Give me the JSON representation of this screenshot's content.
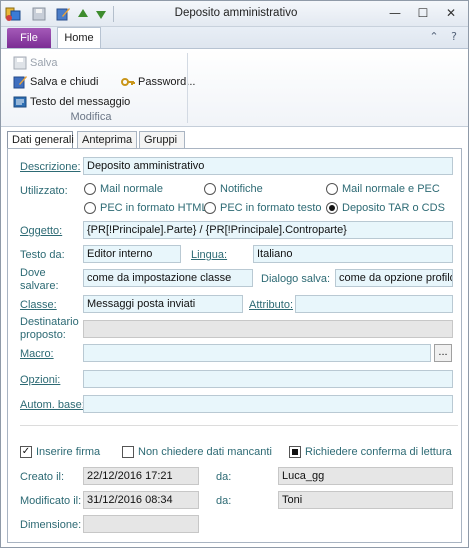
{
  "window": {
    "title": "Deposito amministrativo"
  },
  "quick_access": {
    "icons": [
      "app-icon",
      "save-icon",
      "edit-icon",
      "up-arrow-icon",
      "down-arrow-icon"
    ]
  },
  "ribbon": {
    "file_tab": "File",
    "home_tab": "Home",
    "buttons": {
      "salva": "Salva",
      "salva_chiudi": "Salva e chiudi",
      "password": "Password...",
      "testo_messaggio": "Testo del messaggio"
    },
    "group_label": "Modifica"
  },
  "tabs": [
    "Dati generali",
    "Anteprima",
    "Gruppi"
  ],
  "form": {
    "descrizione": {
      "label": "Descrizione:",
      "value": "Deposito amministrativo"
    },
    "utilizzato": {
      "label": "Utilizzato:",
      "options": [
        "Mail normale",
        "Notifiche",
        "Mail normale e PEC",
        "PEC in formato HTML",
        "PEC in formato testo",
        "Deposito TAR o CDS"
      ],
      "selected": "Deposito TAR o CDS"
    },
    "oggetto": {
      "label": "Oggetto:",
      "value": "{PR[!Principale].Parte} / {PR[!Principale].Controparte}"
    },
    "testo_da": {
      "label": "Testo da:",
      "value": "Editor interno"
    },
    "lingua": {
      "label": "Lingua:",
      "value": "Italiano"
    },
    "dove_salvare": {
      "label_line1": "Dove",
      "label_line2": "salvare:",
      "value": "come da impostazione classe"
    },
    "dialogo_salva": {
      "label": "Dialogo salva:",
      "value": "come da opzione profilo"
    },
    "classe": {
      "label": "Classe:",
      "value": "Messaggi posta inviati"
    },
    "attributo": {
      "label": "Attributo:",
      "value": ""
    },
    "destinatario": {
      "label_line1": "Destinatario",
      "label_line2": "proposto:",
      "value": ""
    },
    "macro": {
      "label": "Macro:",
      "value": "",
      "button": "..."
    },
    "opzioni": {
      "label": "Opzioni:",
      "value": ""
    },
    "autom_base": {
      "label": "Autom. base:",
      "value": ""
    },
    "inserire_firma": {
      "label": "Inserire firma",
      "checked": true
    },
    "non_chiedere": {
      "label": "Non chiedere dati mancanti",
      "checked": false
    },
    "richiedere_conferma": {
      "label": "Richiedere conferma di lettura",
      "checked": true
    },
    "creato_il": {
      "label": "Creato il:",
      "value": "22/12/2016 17:21"
    },
    "creato_da": {
      "label": "da:",
      "value": "Luca_gg"
    },
    "modificato_il": {
      "label": "Modificato il:",
      "value": "31/12/2016 08:34"
    },
    "modificato_da": {
      "label": "da:",
      "value": "Toni"
    },
    "dimensione": {
      "label": "Dimensione:",
      "value": ""
    }
  },
  "colors": {
    "label_teal": "#2d6a74",
    "field_bg": "#e8f6fb",
    "file_tab": "#7b2d94"
  }
}
